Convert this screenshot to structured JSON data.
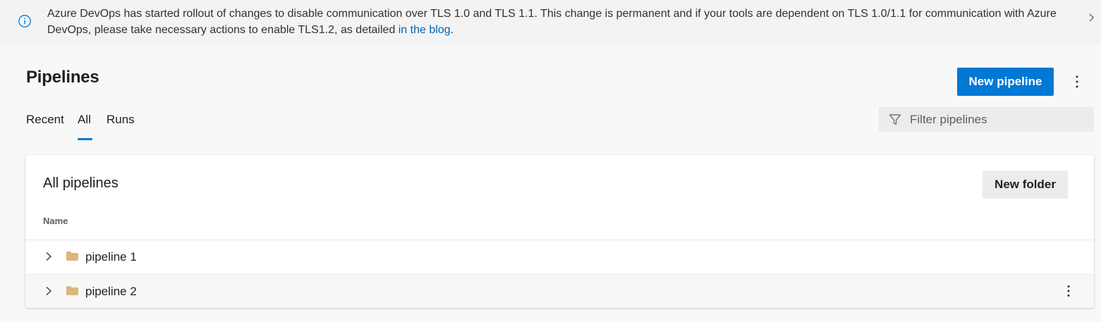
{
  "banner": {
    "text": "Azure DevOps has started rollout of changes to disable communication over TLS 1.0 and TLS 1.1. This change is permanent and if your tools are dependent on TLS 1.0/1.1 for communication with Azure DevOps, please take necessary actions to enable TLS1.2, as detailed ",
    "link_text": "in the blog",
    "suffix": ".",
    "icon": "info-icon",
    "close_icon": "chevron-right-icon"
  },
  "header": {
    "title": "Pipelines",
    "new_pipeline_label": "New pipeline",
    "more_icon": "more-vertical-icon"
  },
  "tabs": [
    {
      "label": "Recent",
      "selected": false
    },
    {
      "label": "All",
      "selected": true
    },
    {
      "label": "Runs",
      "selected": false
    }
  ],
  "filter": {
    "placeholder": "Filter pipelines",
    "value": "",
    "icon": "filter-icon"
  },
  "card": {
    "title": "All pipelines",
    "new_folder_label": "New folder",
    "column_header": "Name",
    "rows": [
      {
        "label": "pipeline 1",
        "icon": "folder-icon",
        "expand_icon": "chevron-right-icon"
      },
      {
        "label": "pipeline 2",
        "icon": "folder-icon",
        "expand_icon": "chevron-right-icon",
        "more_icon": "more-vertical-icon"
      }
    ]
  },
  "colors": {
    "accent": "#0078d4",
    "link": "#0063b1",
    "folder": "#dcb67a"
  }
}
